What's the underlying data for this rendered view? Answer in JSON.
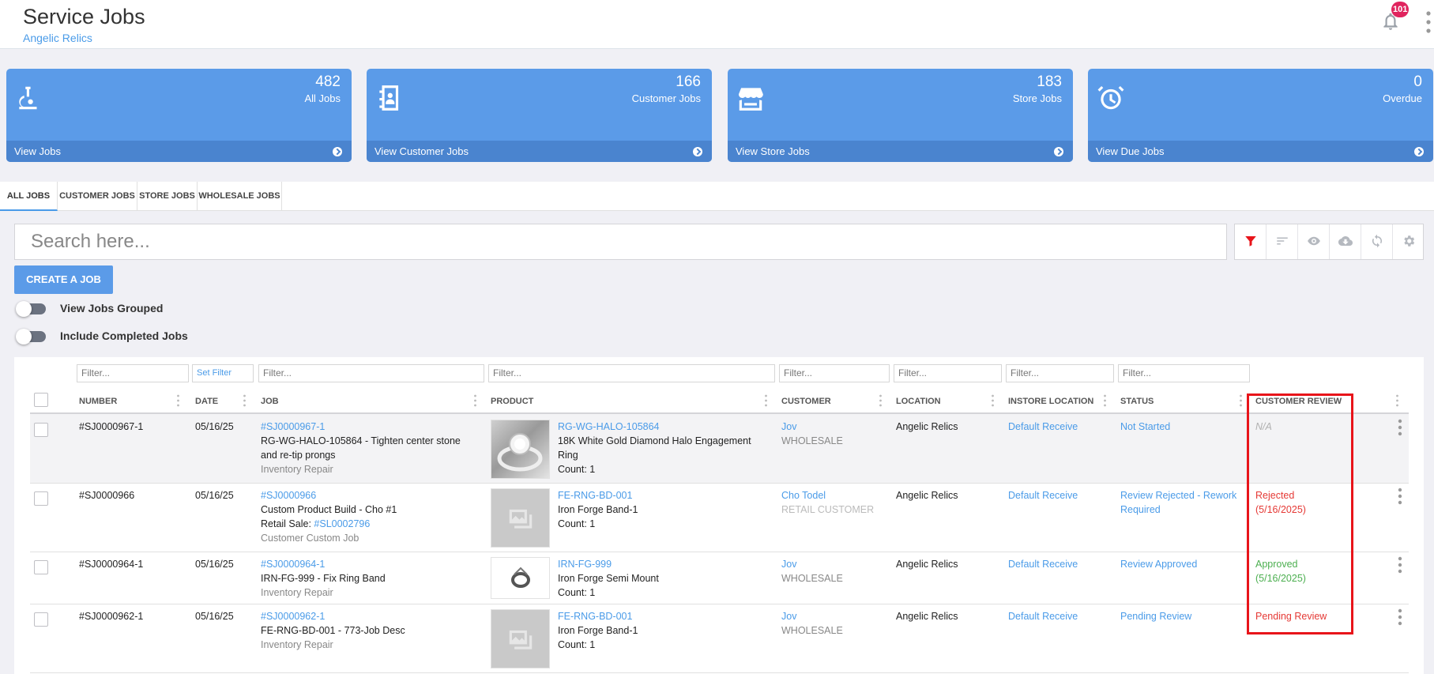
{
  "header": {
    "title": "Service Jobs",
    "subtitle": "Angelic Relics",
    "notification_count": "101"
  },
  "cards": [
    {
      "count": "482",
      "label": "All Jobs",
      "link": "View Jobs",
      "icon": "microscope-icon"
    },
    {
      "count": "166",
      "label": "Customer Jobs",
      "link": "View Customer Jobs",
      "icon": "contact-book-icon"
    },
    {
      "count": "183",
      "label": "Store Jobs",
      "link": "View Store Jobs",
      "icon": "storefront-icon"
    },
    {
      "count": "0",
      "label": "Overdue",
      "link": "View Due Jobs",
      "icon": "alarm-clock-icon"
    }
  ],
  "tabs": [
    "ALL JOBS",
    "CUSTOMER JOBS",
    "STORE JOBS",
    "WHOLESALE JOBS"
  ],
  "search": {
    "placeholder": "Search here..."
  },
  "toolbar_icons": [
    "filter-icon",
    "sort-icon",
    "eye-icon",
    "cloud-download-icon",
    "refresh-icon",
    "settings-icon"
  ],
  "actions": {
    "create_job": "CREATE A JOB"
  },
  "toggles": {
    "view_grouped": "View Jobs Grouped",
    "include_completed": "Include Completed Jobs"
  },
  "filters": {
    "placeholder": "Filter...",
    "set_filter": "Set Filter"
  },
  "columns": {
    "number": "NUMBER",
    "date": "DATE",
    "job": "JOB",
    "product": "PRODUCT",
    "customer": "CUSTOMER",
    "location": "LOCATION",
    "instore_location": "INSTORE LOCATION",
    "status": "STATUS",
    "customer_review": "CUSTOMER REVIEW"
  },
  "rows": [
    {
      "number": "#SJ0000967-1",
      "date": "05/16/25",
      "job_link": "#SJ0000967-1",
      "job_title_1": "RG-WG-HALO-105864 - Tighten center stone",
      "job_title_2": "and re-tip prongs",
      "job_type": "Inventory Repair",
      "product_sku": "RG-WG-HALO-105864",
      "product_name_1": "18K White Gold Diamond Halo Engagement",
      "product_name_2": "Ring",
      "product_count": "Count: 1",
      "customer": "Jov",
      "customer_type": "WHOLESALE",
      "location": "Angelic Relics",
      "instore_location": "Default Receive",
      "status": "Not Started",
      "review": "N/A"
    },
    {
      "number": "#SJ0000966",
      "date": "05/16/25",
      "job_link": "#SJ0000966",
      "job_title_1": "Custom Product Build - Cho #1",
      "retail_sale_label": "Retail Sale: ",
      "retail_sale_link": "#SL0002796",
      "job_type": "Customer Custom Job",
      "product_sku": "FE-RNG-BD-001",
      "product_name_1": "Iron Forge Band-1",
      "product_count": "Count: 1",
      "customer": "Cho Todel",
      "customer_type": "RETAIL CUSTOMER",
      "location": "Angelic Relics",
      "instore_location": "Default Receive",
      "status_1": "Review Rejected - Rework",
      "status_2": "Required",
      "review_1": "Rejected",
      "review_2": "(5/16/2025)"
    },
    {
      "number": "#SJ0000964-1",
      "date": "05/16/25",
      "job_link": "#SJ0000964-1",
      "job_title_1": "IRN-FG-999 - Fix Ring Band",
      "job_type": "Inventory Repair",
      "product_sku": "IRN-FG-999",
      "product_name_1": "Iron Forge Semi Mount",
      "product_count": "Count: 1",
      "customer": "Jov",
      "customer_type": "WHOLESALE",
      "location": "Angelic Relics",
      "instore_location": "Default Receive",
      "status": "Review Approved",
      "review_1": "Approved",
      "review_2": "(5/16/2025)"
    },
    {
      "number": "#SJ0000962-1",
      "date": "05/16/25",
      "job_link": "#SJ0000962-1",
      "job_title_1": "FE-RNG-BD-001 - 773-Job Desc",
      "job_type": "Inventory Repair",
      "product_sku": "FE-RNG-BD-001",
      "product_name_1": "Iron Forge Band-1",
      "product_count": "Count: 1",
      "customer": "Jov",
      "customer_type": "WHOLESALE",
      "location": "Angelic Relics",
      "instore_location": "Default Receive",
      "status": "Pending Review",
      "review": "Pending Review"
    }
  ]
}
